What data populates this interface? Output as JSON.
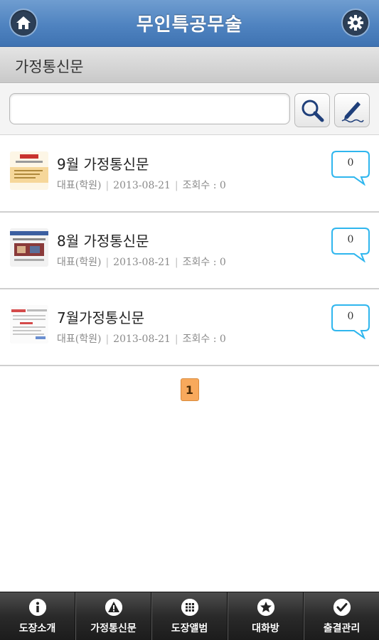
{
  "header": {
    "title": "무인특공무술",
    "home_icon": "home-icon",
    "settings_icon": "gear-icon"
  },
  "section": {
    "title": "가정통신문"
  },
  "search": {
    "value": "",
    "placeholder": ""
  },
  "posts": [
    {
      "title": "9월 가정통신문",
      "author": "대표(학원)",
      "date": "2013-08-21",
      "views": "조회수 : 0",
      "comments": "0"
    },
    {
      "title": "8월 가정통신문",
      "author": "대표(학원)",
      "date": "2013-08-21",
      "views": "조회수 : 0",
      "comments": "0"
    },
    {
      "title": "7월가정통신문",
      "author": "대표(학원)",
      "date": "2013-08-21",
      "views": "조회수 : 0",
      "comments": "0"
    }
  ],
  "pagination": {
    "current": "1"
  },
  "tabs": [
    {
      "label": "도장소개",
      "icon": "info-icon"
    },
    {
      "label": "가정통신문",
      "icon": "warning-icon"
    },
    {
      "label": "도장앨범",
      "icon": "grid-icon"
    },
    {
      "label": "대화방",
      "icon": "star-icon"
    },
    {
      "label": "출결관리",
      "icon": "check-icon"
    }
  ],
  "colors": {
    "header": "#4f83c0",
    "bubble_border": "#2fb6ee",
    "page_active": "#f8a95c"
  }
}
